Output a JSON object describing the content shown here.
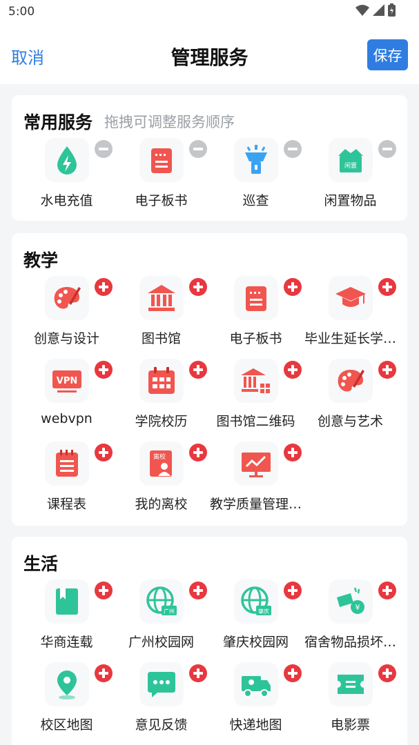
{
  "status": {
    "time": "5:00"
  },
  "nav": {
    "cancel_label": "取消",
    "title": "管理服务",
    "save_label": "保存"
  },
  "common": {
    "title": "常用服务",
    "hint": "拖拽可调整服务顺序",
    "items": [
      {
        "label": "水电充值",
        "icon": "water-drop-icon"
      },
      {
        "label": "电子板书",
        "icon": "board-icon"
      },
      {
        "label": "巡查",
        "icon": "patrol-light-icon"
      },
      {
        "label": "闲置物品",
        "icon": "idle-box-icon",
        "icon_text": "闲置"
      }
    ]
  },
  "teaching": {
    "title": "教学",
    "items": [
      {
        "label": "创意与设计",
        "icon": "palette-icon"
      },
      {
        "label": "图书馆",
        "icon": "library-icon"
      },
      {
        "label": "电子板书",
        "icon": "board-icon"
      },
      {
        "label": "毕业生延长学…",
        "icon": "graduation-cap-icon"
      },
      {
        "label": "webvpn",
        "icon": "vpn-icon",
        "icon_text": "VPN"
      },
      {
        "label": "学院校历",
        "icon": "calendar-icon"
      },
      {
        "label": "图书馆二维码",
        "icon": "library-qr-icon"
      },
      {
        "label": "创意与艺术",
        "icon": "palette-icon"
      },
      {
        "label": "课程表",
        "icon": "timetable-icon"
      },
      {
        "label": "我的离校",
        "icon": "leave-school-icon",
        "icon_text": "离校"
      },
      {
        "label": "教学质量管理…",
        "icon": "quality-chart-icon"
      }
    ]
  },
  "life": {
    "title": "生活",
    "items": [
      {
        "label": "华商连载",
        "icon": "bookmark-icon"
      },
      {
        "label": "广州校园网",
        "icon": "globe-guangzhou-icon",
        "icon_text": "广州"
      },
      {
        "label": "肇庆校园网",
        "icon": "globe-zhaoqing-icon",
        "icon_text": "肇庆"
      },
      {
        "label": "宿舍物品损坏…",
        "icon": "damage-coin-icon"
      },
      {
        "label": "校区地图",
        "icon": "map-pin-icon"
      },
      {
        "label": "意见反馈",
        "icon": "feedback-chat-icon"
      },
      {
        "label": "快递地图",
        "icon": "delivery-truck-icon"
      },
      {
        "label": "电影票",
        "icon": "movie-ticket-icon"
      }
    ]
  },
  "colors": {
    "accent": "#2f7de1",
    "add_badge": "#e8383f",
    "remove_badge": "#c4c6c9",
    "red_icon": "#f0564f",
    "teal_icon": "#2ec49a",
    "blue_icon": "#3aa3f0"
  }
}
